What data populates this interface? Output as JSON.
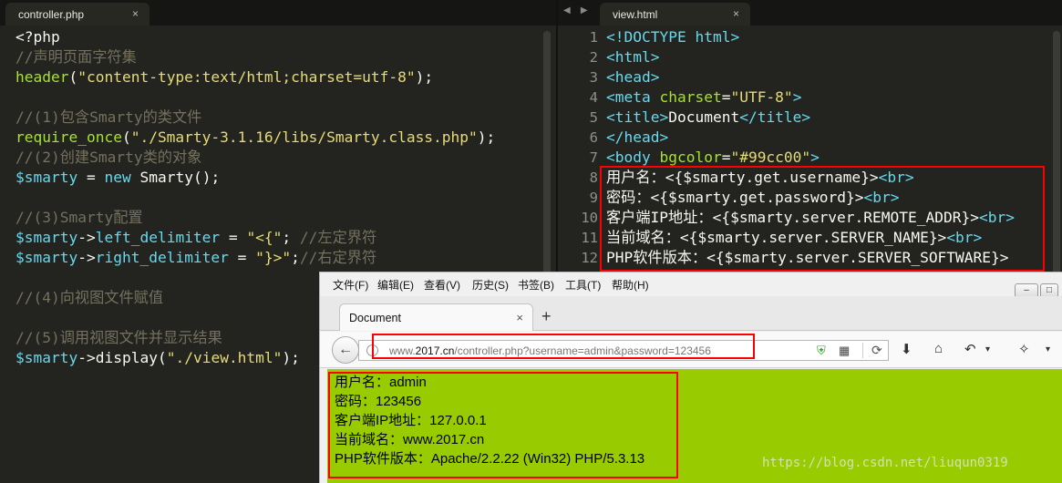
{
  "left_tab": {
    "title": "controller.php",
    "close": "×"
  },
  "right_tab": {
    "title": "view.html",
    "close": "×",
    "nav": "◀ ▶"
  },
  "php_code": [
    [
      {
        "t": "<?php",
        "c": "c-plain"
      }
    ],
    [
      {
        "t": "//声明页面字符集",
        "c": "c-comment"
      }
    ],
    [
      {
        "t": "header",
        "c": "c-func"
      },
      {
        "t": "(",
        "c": "c-plain"
      },
      {
        "t": "\"content-type:text/html;charset=utf-8\"",
        "c": "c-str"
      },
      {
        "t": ");",
        "c": "c-plain"
      }
    ],
    [],
    [
      {
        "t": "//(1)包含Smarty的类文件",
        "c": "c-comment"
      }
    ],
    [
      {
        "t": "require_once",
        "c": "c-func"
      },
      {
        "t": "(",
        "c": "c-plain"
      },
      {
        "t": "\"./Smarty-3.1.16/libs/Smarty.class.php\"",
        "c": "c-str"
      },
      {
        "t": ");",
        "c": "c-plain"
      }
    ],
    [
      {
        "t": "//(2)创建Smarty类的对象",
        "c": "c-comment"
      }
    ],
    [
      {
        "t": "$smarty",
        "c": "c-var"
      },
      {
        "t": " = ",
        "c": "c-plain"
      },
      {
        "t": "new",
        "c": "c-kw"
      },
      {
        "t": " Smarty();",
        "c": "c-plain"
      }
    ],
    [],
    [
      {
        "t": "//(3)Smarty配置",
        "c": "c-comment"
      }
    ],
    [
      {
        "t": "$smarty",
        "c": "c-var"
      },
      {
        "t": "->",
        "c": "c-plain"
      },
      {
        "t": "left_delimiter",
        "c": "c-var"
      },
      {
        "t": " = ",
        "c": "c-plain"
      },
      {
        "t": "\"<{\"",
        "c": "c-str"
      },
      {
        "t": "; ",
        "c": "c-plain"
      },
      {
        "t": "//左定界符",
        "c": "c-comment"
      }
    ],
    [
      {
        "t": "$smarty",
        "c": "c-var"
      },
      {
        "t": "->",
        "c": "c-plain"
      },
      {
        "t": "right_delimiter",
        "c": "c-var"
      },
      {
        "t": " = ",
        "c": "c-plain"
      },
      {
        "t": "\"}>\"",
        "c": "c-str"
      },
      {
        "t": ";",
        "c": "c-plain"
      },
      {
        "t": "//右定界符",
        "c": "c-comment"
      }
    ],
    [],
    [
      {
        "t": "//(4)向视图文件赋值",
        "c": "c-comment"
      }
    ],
    [],
    [
      {
        "t": "//(5)调用视图文件并显示结果",
        "c": "c-comment"
      }
    ],
    [
      {
        "t": "$smarty",
        "c": "c-var"
      },
      {
        "t": "->",
        "c": "c-plain"
      },
      {
        "t": "display",
        "c": "c-plain"
      },
      {
        "t": "(",
        "c": "c-plain"
      },
      {
        "t": "\"./view.html\"",
        "c": "c-str"
      },
      {
        "t": ");",
        "c": "c-plain"
      }
    ]
  ],
  "html_line_numbers": [
    "1",
    "2",
    "3",
    "4",
    "5",
    "6",
    "7",
    "8",
    "9",
    "10",
    "11",
    "12"
  ],
  "html_code": [
    [
      {
        "t": "<!DOCTYPE html>",
        "c": "c-tag"
      }
    ],
    [
      {
        "t": "<html>",
        "c": "c-tag"
      }
    ],
    [
      {
        "t": "<head>",
        "c": "c-tag"
      }
    ],
    [
      {
        "t": "<meta",
        "c": "c-tag"
      },
      {
        "t": " charset",
        "c": "c-attr"
      },
      {
        "t": "=",
        "c": "c-plain"
      },
      {
        "t": "\"UTF-8\"",
        "c": "c-str"
      },
      {
        "t": ">",
        "c": "c-tag"
      }
    ],
    [
      {
        "t": "<title>",
        "c": "c-tag"
      },
      {
        "t": "Document",
        "c": "c-plain"
      },
      {
        "t": "</title>",
        "c": "c-tag"
      }
    ],
    [
      {
        "t": "</head>",
        "c": "c-tag"
      }
    ],
    [
      {
        "t": "<body",
        "c": "c-tag"
      },
      {
        "t": " bgcolor",
        "c": "c-attr"
      },
      {
        "t": "=",
        "c": "c-plain"
      },
      {
        "t": "\"#99cc00\"",
        "c": "c-str"
      },
      {
        "t": ">",
        "c": "c-tag"
      }
    ],
    [
      {
        "t": "用户名：<{$smarty.get.username}>",
        "c": "c-plain"
      },
      {
        "t": "<br>",
        "c": "c-tag"
      }
    ],
    [
      {
        "t": "密码：<{$smarty.get.password}>",
        "c": "c-plain"
      },
      {
        "t": "<br>",
        "c": "c-tag"
      }
    ],
    [
      {
        "t": "客户端IP地址：<{$smarty.server.REMOTE_ADDR}>",
        "c": "c-plain"
      },
      {
        "t": "<br>",
        "c": "c-tag"
      }
    ],
    [
      {
        "t": "当前域名：<{$smarty.server.SERVER_NAME}>",
        "c": "c-plain"
      },
      {
        "t": "<br>",
        "c": "c-tag"
      }
    ],
    [
      {
        "t": "PHP软件版本：<{$smarty.server.SERVER_SOFTWARE}>",
        "c": "c-plain"
      }
    ]
  ],
  "browser": {
    "menu": [
      "文件(F)",
      "编辑(E)",
      "查看(V)",
      "历史(S)",
      "书签(B)",
      "工具(T)",
      "帮助(H)"
    ],
    "tab_title": "Document",
    "tab_close": "×",
    "new_tab": "+",
    "url_prefix": "www.",
    "url_domain": "2017.cn",
    "url_rest": "/controller.php?username=admin&password=123456",
    "output": [
      "用户名：admin",
      "密码：123456",
      "客户端IP地址：127.0.0.1",
      "当前域名：www.2017.cn",
      "PHP软件版本：Apache/2.2.22 (Win32) PHP/5.3.13"
    ]
  },
  "watermark": "https://blog.csdn.net/liuqun0319",
  "colors": {
    "highlight_box": "#ff0000",
    "page_bg": "#99cc00",
    "editor_bg": "#23241f"
  }
}
